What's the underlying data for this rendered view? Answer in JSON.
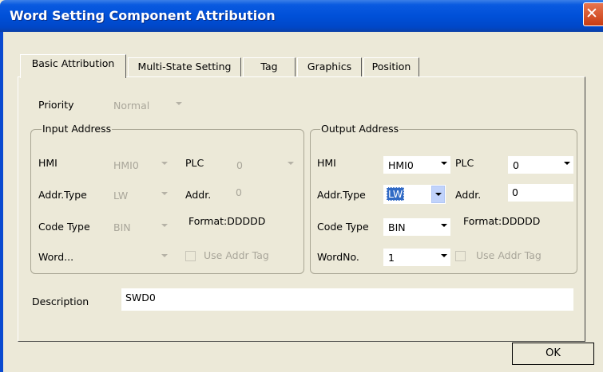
{
  "window": {
    "title": "Word Setting Component Attribution"
  },
  "tabs": [
    {
      "label": "Basic Attribution",
      "selected": true
    },
    {
      "label": "Multi-State Setting"
    },
    {
      "label": "Tag"
    },
    {
      "label": "Graphics"
    },
    {
      "label": "Position"
    }
  ],
  "priority": {
    "label": "Priority",
    "value": "Normal"
  },
  "input": {
    "group_title": "Input Address",
    "hmi_label": "HMI",
    "hmi_value": "HMI0",
    "plc_label": "PLC",
    "plc_value": "0",
    "addr_type_label": "Addr.Type",
    "addr_type_value": "LW",
    "addr_label": "Addr.",
    "addr_value": "0",
    "code_type_label": "Code Type",
    "code_type_value": "BIN",
    "format": "Format:DDDDD",
    "word_label": "Word...",
    "word_value": "",
    "use_addr_tag": "Use Addr Tag"
  },
  "output": {
    "group_title": "Output Address",
    "hmi_label": "HMI",
    "hmi_value": "HMI0",
    "plc_label": "PLC",
    "plc_value": "0",
    "addr_type_label": "Addr.Type",
    "addr_type_value": "LW",
    "addr_label": "Addr.",
    "addr_value": "0",
    "code_type_label": "Code Type",
    "code_type_value": "BIN",
    "format": "Format:DDDDD",
    "wordno_label": "WordNo.",
    "wordno_value": "1",
    "use_addr_tag": "Use Addr Tag"
  },
  "description": {
    "label": "Description",
    "value": "SWD0"
  },
  "buttons": {
    "ok": "OK"
  }
}
